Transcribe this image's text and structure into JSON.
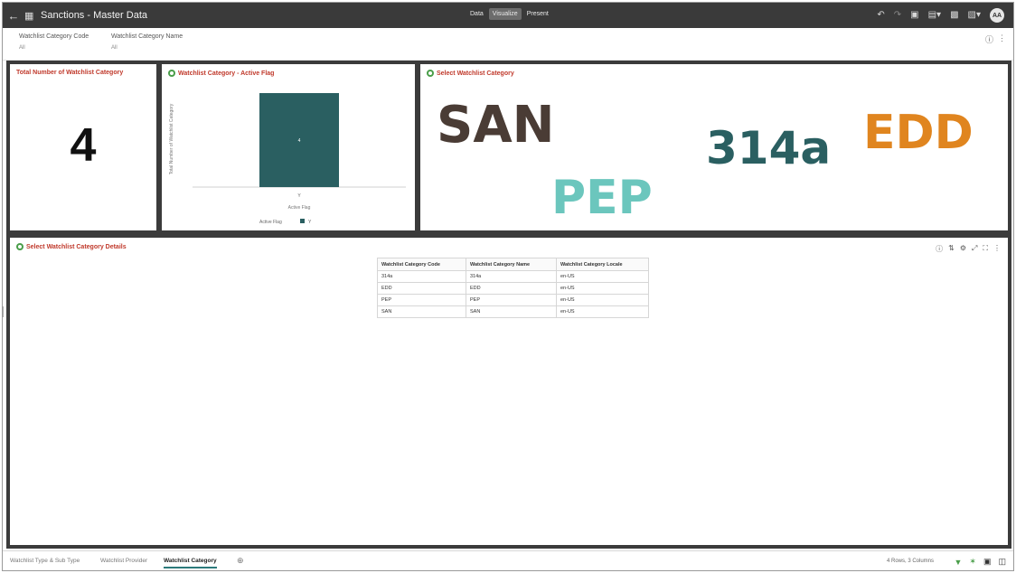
{
  "header": {
    "back_icon": "arrow-left-icon",
    "app_icon": "workbook-icon",
    "title": "Sanctions - Master Data",
    "modes": [
      {
        "label": "Data",
        "active": false
      },
      {
        "label": "Visualize",
        "active": true
      },
      {
        "label": "Present",
        "active": false
      }
    ],
    "tools": [
      "undo-icon",
      "redo-icon",
      "save-icon",
      "add-icon",
      "preview-icon",
      "menu-icon"
    ],
    "avatar_initials": "AA"
  },
  "filters": [
    {
      "label": "Watchlist Category Code",
      "value": "All"
    },
    {
      "label": "Watchlist Category Name",
      "value": "All"
    }
  ],
  "tiles": {
    "total": {
      "title": "Total Number of Watchlist Category",
      "value": "4"
    },
    "active_flag": {
      "title": "Watchlist Category - Active Flag",
      "y_axis_label": "Total Number of Watchlist Category",
      "x_axis_label": "Active Flag",
      "bar_data_label": "4",
      "legend_title": "Active Flag",
      "legend_item": "Y"
    },
    "wordcloud": {
      "title": "Select Watchlist Category",
      "words": [
        {
          "text": "SAN",
          "color": "#4a3c35"
        },
        {
          "text": "314a",
          "color": "#2a5f61"
        },
        {
          "text": "EDD",
          "color": "#e0851f"
        },
        {
          "text": "PEP",
          "color": "#6bc6bd"
        }
      ]
    },
    "details": {
      "title": "Select Watchlist Category Details",
      "columns": [
        "Watchlist Category Code",
        "Watchlist Category Name",
        "Watchlist Category Locale"
      ],
      "rows": [
        [
          "314a",
          "314a",
          "en-US"
        ],
        [
          "EDD",
          "EDD",
          "en-US"
        ],
        [
          "PEP",
          "PEP",
          "en-US"
        ],
        [
          "SAN",
          "SAN",
          "en-US"
        ]
      ]
    }
  },
  "chart_data": {
    "type": "bar",
    "title": "Watchlist Category - Active Flag",
    "categories": [
      "Y"
    ],
    "values": [
      4
    ],
    "xlabel": "Active Flag",
    "ylabel": "Total Number of Watchlist Category",
    "ylim": [
      0,
      4
    ],
    "grid": false,
    "legend": "bottom",
    "colors": [
      "#2a5f61"
    ]
  },
  "footer": {
    "tabs": [
      {
        "label": "Watchlist Type & Sub Type",
        "active": false
      },
      {
        "label": "Watchlist Provider",
        "active": false
      },
      {
        "label": "Watchlist Category",
        "active": true
      }
    ],
    "row_info": "4 Rows, 3 Columns"
  }
}
